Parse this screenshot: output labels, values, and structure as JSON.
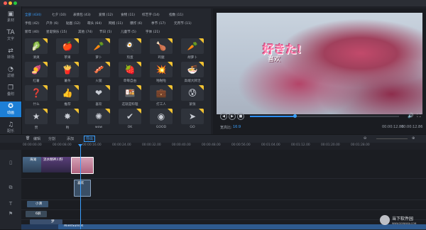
{
  "window": {
    "close": "close",
    "minimize": "minimize",
    "zoom": "zoom"
  },
  "sidebar": {
    "items": [
      {
        "label": "素材",
        "icon": "▣"
      },
      {
        "label": "文字",
        "icon": "TA"
      },
      {
        "label": "转场",
        "icon": "⇄"
      },
      {
        "label": "滤镜",
        "icon": "◔"
      },
      {
        "label": "叠附",
        "icon": "❐"
      },
      {
        "label": "动画",
        "icon": "✪"
      },
      {
        "label": "配乐",
        "icon": "♫"
      }
    ]
  },
  "library": {
    "categories_row1": [
      "全部 (434)",
      "七夕 (10)",
      "表情包 (43)",
      "爱情 (12)",
      "食物 (11)",
      "综艺字 (14)",
      "指数 (11)"
    ],
    "categories_row2": [
      "手指 (42)",
      "户外 (6)",
      "贴图 (12)",
      "萌头 (64)",
      "网络 (11)",
      "爆炸 (6)",
      "季节 (17)",
      "元宵节 (11)"
    ],
    "categories_row3": [
      "新年 (40)",
      "星诞快乐 (15)",
      "其他 (74)",
      "节日 (5)",
      "儿童节 (5)",
      "字体 (21)"
    ],
    "items": [
      {
        "label": "清爽",
        "sym": "🥬"
      },
      {
        "label": "苹果",
        "sym": "🍎"
      },
      {
        "label": "萝卜",
        "sym": "🥕"
      },
      {
        "label": "煎蛋",
        "sym": "🍳"
      },
      {
        "label": "鸡腿",
        "sym": "🍗"
      },
      {
        "label": "胡萝卜",
        "sym": "🥕"
      },
      {
        "label": "红薯",
        "sym": "🍠"
      },
      {
        "label": "薯条",
        "sym": "🍟"
      },
      {
        "label": "火腿",
        "sym": "🥓"
      },
      {
        "label": "草莓自由",
        "sym": "🍓"
      },
      {
        "label": "啪啪啦",
        "sym": "💥"
      },
      {
        "label": "高端大牌活",
        "sym": "🍜"
      },
      {
        "label": "什么",
        "sym": "❓"
      },
      {
        "label": "推荐",
        "sym": "👍"
      },
      {
        "label": "喜欢",
        "sym": "❤"
      },
      {
        "label": "这就是料理",
        "sym": "🍱"
      },
      {
        "label": "打工人",
        "sym": "💼"
      },
      {
        "label": "紧张",
        "sym": "😰"
      },
      {
        "label": "赞",
        "sym": "★"
      },
      {
        "label": "哟",
        "sym": "✸"
      },
      {
        "label": "wow",
        "sym": "✺"
      },
      {
        "label": "OK",
        "sym": "✔"
      },
      {
        "label": "GOOD",
        "sym": "◉"
      },
      {
        "label": "GO",
        "sym": "➤"
      }
    ]
  },
  "preview": {
    "overlay_title": "好きた!",
    "overlay_sub": "喜欢",
    "aspect_label": "宽高比:",
    "aspect_value": "16:9",
    "time_current": "00:00:12.86",
    "time_total": "00:00:12.86",
    "progress": 0.3
  },
  "toolbar": {
    "items": [
      "删除",
      "编辑",
      "分割",
      "添加",
      "导出"
    ],
    "selected": "导出"
  },
  "ruler": {
    "ticks": [
      "00:00:00.00",
      "00:00:08.00",
      "00:00:16.00",
      "00:00:24.00",
      "00:00:32.00",
      "00:00:40.00",
      "00:00:48.00",
      "00:00:56.00",
      "00:01:04.00",
      "00:01:12.00",
      "00:01:20.00",
      "00:01:28.00"
    ]
  },
  "timeline": {
    "clips": [
      {
        "label": "海滩",
        "track": 0
      },
      {
        "label": "流水精神川籽",
        "track": 0
      },
      {
        "label": "",
        "track": 0
      },
      {
        "label": "喜欢",
        "track": 1
      },
      {
        "label": "小清",
        "track": 2
      },
      {
        "label": "6屏",
        "track": 3
      },
      {
        "label": "梦",
        "track": 4
      },
      {
        "label": "AlienSunset",
        "track": 5
      }
    ]
  },
  "watermark": {
    "text": "当下软件园",
    "sub": "WWW.DOWNXIA.COM"
  }
}
